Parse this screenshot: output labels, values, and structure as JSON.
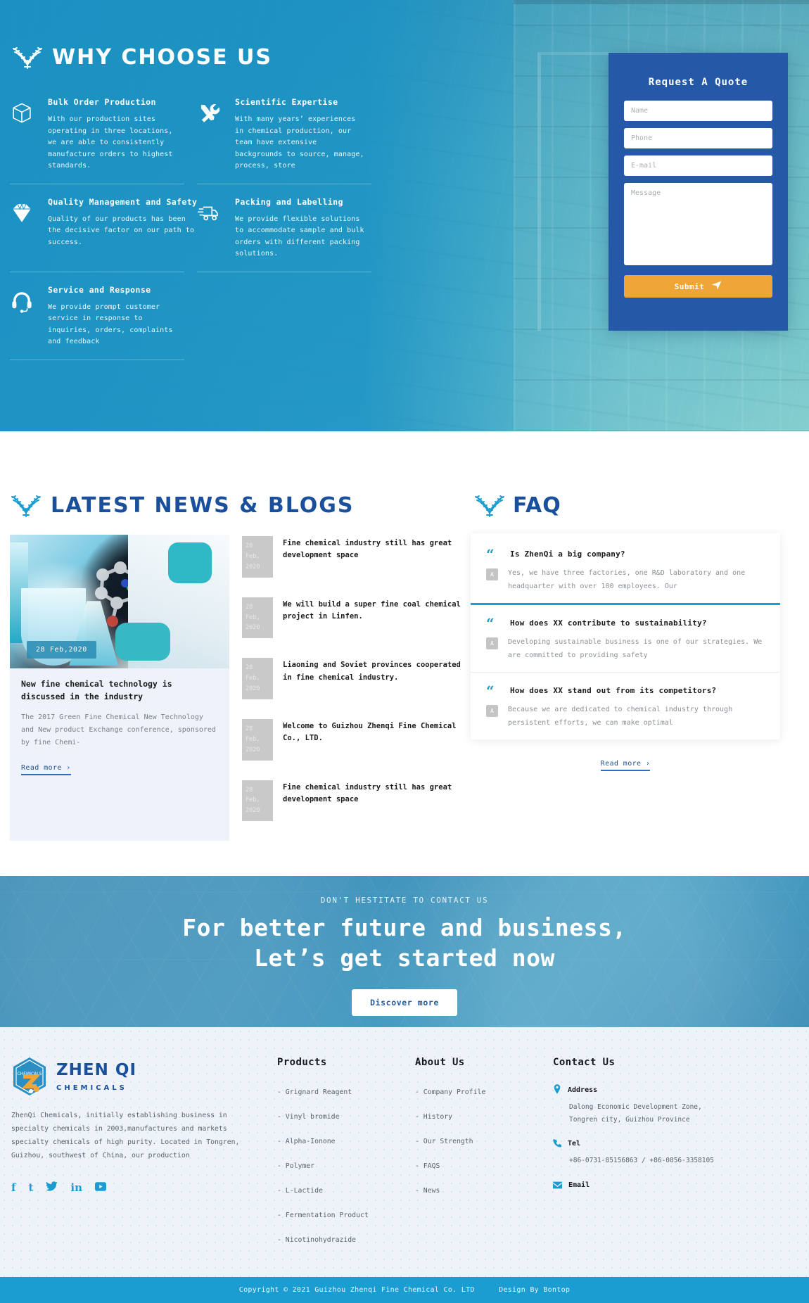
{
  "hero": {
    "title": "WHY CHOOSE US",
    "features": [
      {
        "icon": "box-icon",
        "title": "Bulk Order Production",
        "text": "With our production sites operating in three locations, we are able to consistently manufacture orders to highest standards."
      },
      {
        "icon": "tools-icon",
        "title": "Scientific Expertise",
        "text": "With many years’ experiences in chemical production, our team have extensive backgrounds to source, manage, process, store"
      },
      {
        "icon": "diamond-icon",
        "title": "Quality Management and Safety",
        "text": "Quality of our products has been the decisive factor on our path to success."
      },
      {
        "icon": "truck-icon",
        "title": "Packing and Labelling",
        "text": "We provide flexible solutions to accommodate sample and bulk orders with different packing solutions."
      },
      {
        "icon": "headset-icon",
        "title": "Service and Response",
        "text": "We provide prompt customer service in response to inquiries, orders, complaints and feedback"
      }
    ]
  },
  "quote": {
    "title": "Request A Quote",
    "name_placeholder": "Name",
    "phone_placeholder": "Phone",
    "email_placeholder": "E-mail",
    "message_placeholder": "Message",
    "submit_label": "Submit"
  },
  "news": {
    "title": "LATEST NEWS & BLOGS",
    "featured": {
      "date": "28 Feb,2020",
      "title": "New fine chemical technology is discussed in the industry",
      "excerpt": "The 2017 Green Fine Chemical New Technology and New product Exchange conference, sponsored by fine Chemi-",
      "read_more": "Read more  ›"
    },
    "items": [
      {
        "day": "28 Feb,",
        "year": "2020",
        "title": "Fine chemical industry still has great development space"
      },
      {
        "day": "28 Feb,",
        "year": "2020",
        "title": "We will build a super fine coal chemical project in Linfen."
      },
      {
        "day": "28 Feb,",
        "year": "2020",
        "title": "Liaoning and Soviet provinces cooperated in fine chemical industry."
      },
      {
        "day": "28 Feb,",
        "year": "2020",
        "title": "Welcome to Guizhou Zhenqi Fine Chemical Co., LTD."
      },
      {
        "day": "28 Feb,",
        "year": "2020",
        "title": "Fine chemical industry still has great development space"
      }
    ]
  },
  "faq": {
    "title": "FAQ",
    "answer_badge": "A",
    "read_more": "Read more  ›",
    "items": [
      {
        "question": "Is ZhenQi a big company?",
        "answer": "Yes, we have three factories, one R&D laboratory and one headquarter with over 100 employees. Our"
      },
      {
        "question": "How does XX contribute to sustainability?",
        "answer": "Developing sustainable business is one of our strategies. We are committed to providing safety"
      },
      {
        "question": "How does XX stand out from its competitors?",
        "answer": "Because we are dedicated to chemical industry through persistent efforts, we can make optimal"
      }
    ]
  },
  "cta": {
    "eyebrow": "DON'T HESTITATE TO CONTACT US",
    "heading_line1": "For better future and business,",
    "heading_line2": "Let’s get started now",
    "button": "Discover more"
  },
  "footer": {
    "logo_main": "ZHEN QI",
    "logo_sub": "CHEMICALS",
    "logo_badge": "CHEMICALS",
    "about": "ZhenQi Chemicals, initially establishing business in specialty chemicals in 2003,manufactures and markets specialty chemicals of high purity. Located in Tongren, Guizhou, southwest of China, our production",
    "socials": [
      {
        "name": "facebook-icon",
        "glyph": "f"
      },
      {
        "name": "tumblr-icon",
        "glyph": "t"
      },
      {
        "name": "twitter-icon",
        "glyph": "🐦"
      },
      {
        "name": "linkedin-icon",
        "glyph": "in"
      },
      {
        "name": "youtube-icon",
        "glyph": "▶"
      }
    ],
    "products": {
      "title": "Products",
      "items": [
        "- Grignard Reagent",
        "- Vinyl bromide",
        "- Alpha-Ionone",
        "- Polymer",
        "- L-Lactide",
        "- Fermentation Product",
        "- Nicotinohydrazide"
      ]
    },
    "about_us": {
      "title": "About Us",
      "items": [
        "- Company Profile",
        "- History",
        "- Our Strength",
        "- FAQS",
        "- News"
      ]
    },
    "contact": {
      "title": "Contact Us",
      "address_label": "Address",
      "address_value": "Dalong Economic Development Zone, Tongren city, Guizhou Province",
      "tel_label": "Tel",
      "tel_value": "+86-0731-85156863 / +86-0856-3358105",
      "email_label": "Email"
    },
    "copyright": "Copyright © 2021 Guizhou Zhenqi Fine Chemical Co. LTD",
    "design_by": "Design By Bontop"
  }
}
